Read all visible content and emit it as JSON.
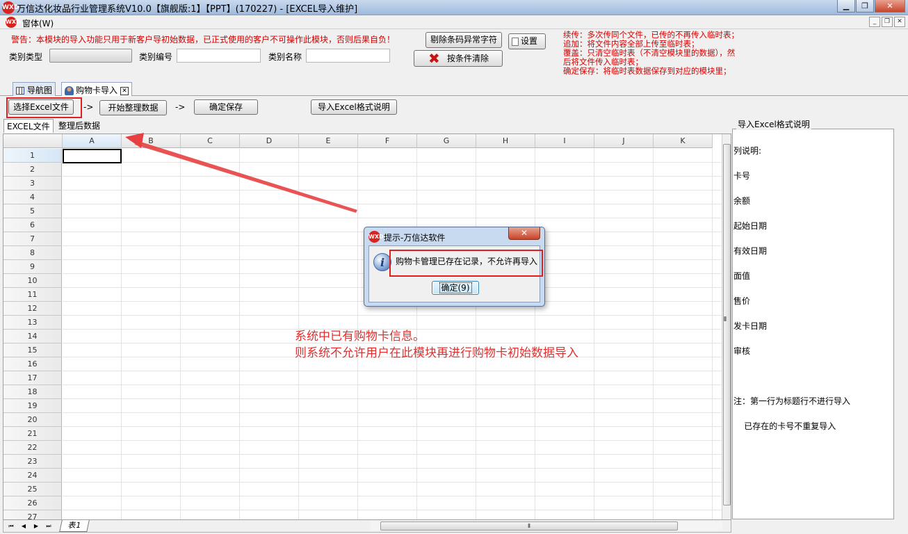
{
  "window": {
    "title": "万信达化妆品行业管理系统V10.0【旗舰版:1】【PPT】(170227) - [EXCEL导入维护]",
    "logo_text": "WXD",
    "minimize": "▁",
    "maximize": "❐",
    "close": "✕"
  },
  "menubar": {
    "item": "窗体(W)",
    "mdi_minimize": "_",
    "mdi_restore": "❐",
    "mdi_close": "✕"
  },
  "top": {
    "warning": "警告：本模块的导入功能只用于新客户导初始数据，已正式使用的客户不可操作此模块，否则后果自负！",
    "category_type_label": "类别类型",
    "category_code_label": "类别编号",
    "category_name_label": "类别名称",
    "remove_barcode_button": "剔除条码异常字符",
    "settings_button": "设置",
    "clear_by_condition_button": "按条件清除",
    "notes": [
      "续传：多次传同个文件，已传的不再传入临时表；",
      "追加：将文件内容全部上传至临时表；",
      "覆盖：只清空临时表（不清空模块里的数据），然",
      "后将文件传入临时表；",
      "确定保存：将临时表数据保存到对应的模块里；"
    ]
  },
  "doctabs": {
    "nav_tab": "导航图",
    "import_tab": "购物卡导入",
    "close": "✕"
  },
  "steps": {
    "select_excel": "选择Excel文件",
    "arrow1": "->",
    "start_organize": "开始整理数据",
    "arrow2": "->",
    "confirm_save": "确定保存",
    "format_help": "导入Excel格式说明"
  },
  "subtabs": {
    "excel_file": "EXCEL文件",
    "organized_data": "整理后数据"
  },
  "sheet": {
    "columns": [
      "A",
      "B",
      "C",
      "D",
      "E",
      "F",
      "G",
      "H",
      "I",
      "J",
      "K"
    ],
    "rows": [
      "1",
      "2",
      "3",
      "4",
      "5",
      "6",
      "7",
      "8",
      "9",
      "10",
      "11",
      "12",
      "13",
      "14",
      "15",
      "16",
      "17",
      "18",
      "19",
      "20",
      "21",
      "22",
      "23",
      "24",
      "25",
      "26",
      "27"
    ],
    "sheet_tab": "表1",
    "nav": [
      "⏮",
      "◀",
      "▶",
      "⏭"
    ],
    "scroll_grip": "⦀"
  },
  "right_panel": {
    "title": "导入Excel格式说明",
    "lines": [
      "列说明:",
      "卡号",
      "余额",
      "起始日期",
      "有效日期",
      "面值",
      "售价",
      "发卡日期",
      "审核",
      "",
      "注：第一行为标题行不进行导入",
      "    已存在的卡号不重复导入"
    ]
  },
  "dialog": {
    "title": "提示-万信达软件",
    "message": "购物卡管理已存在记录，不允许再导入",
    "ok_button": "确定(9)",
    "close": "✕",
    "info_glyph": "i"
  },
  "annotation": {
    "line1": "系统中已有购物卡信息。",
    "line2": "则系统不允许用户在此模块再进行购物卡初始数据导入"
  },
  "colors": {
    "warning_red": "#d40000",
    "annotation_red": "#e03030",
    "highlight_box": "#e02020"
  }
}
